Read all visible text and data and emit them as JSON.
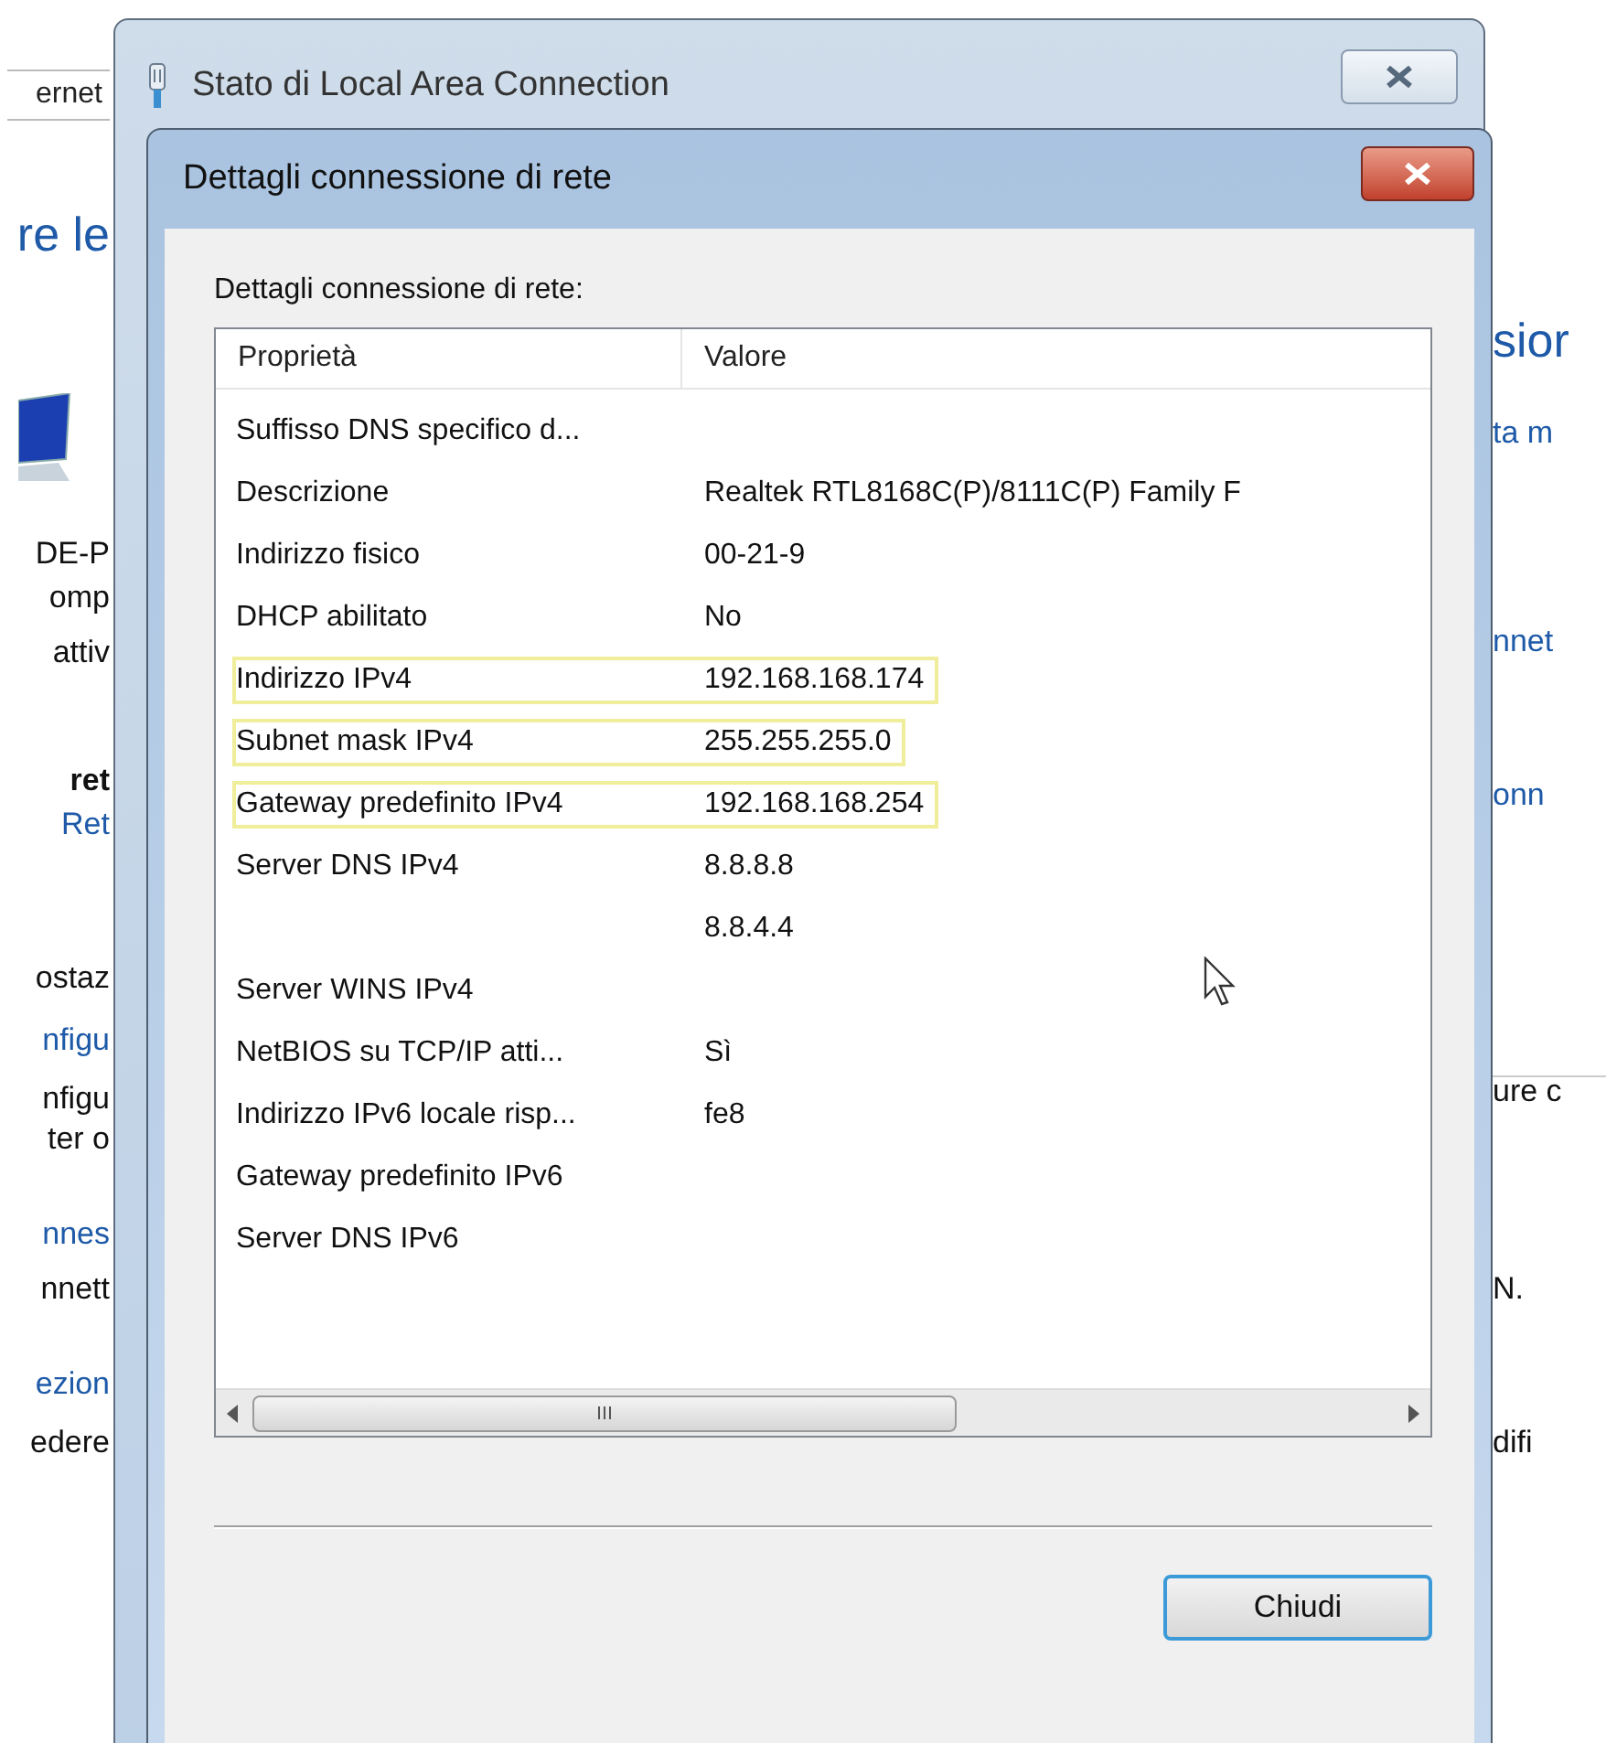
{
  "background_window": {
    "left_fragments": [
      {
        "text": "ernet",
        "kind": "field"
      },
      {
        "text": "re le",
        "kind": "heading"
      },
      {
        "kind": "computer"
      },
      {
        "text": "DE-P",
        "kind": "text"
      },
      {
        "text": "omp",
        "kind": "text"
      },
      {
        "text": "attiv",
        "kind": "text"
      },
      {
        "text": "ret",
        "kind": "bold"
      },
      {
        "text": "Ret",
        "kind": "link"
      },
      {
        "text": "ostaz",
        "kind": "text"
      },
      {
        "text": "nfigu",
        "kind": "link"
      },
      {
        "text": "nfigu",
        "kind": "text"
      },
      {
        "text": "ter o",
        "kind": "text"
      },
      {
        "text": "nnes",
        "kind": "link"
      },
      {
        "text": "nnett",
        "kind": "text"
      },
      {
        "text": "ezion",
        "kind": "link"
      },
      {
        "text": "edere",
        "kind": "text"
      }
    ],
    "right_fragments": [
      {
        "text": "sior",
        "kind": "heading"
      },
      {
        "text": "ta m",
        "kind": "link"
      },
      {
        "text": "nnet",
        "kind": "link"
      },
      {
        "text": "onn",
        "kind": "link"
      },
      {
        "text": "ure c",
        "kind": "text"
      },
      {
        "text": "N.",
        "kind": "text"
      },
      {
        "text": "difi",
        "kind": "text"
      }
    ]
  },
  "status_dialog": {
    "title": "Stato di Local Area Connection"
  },
  "details_dialog": {
    "title": "Dettagli connessione di rete",
    "label": "Dettagli connessione di rete:",
    "columns": [
      "Proprietà",
      "Valore"
    ],
    "rows": [
      {
        "property": "Suffisso DNS specifico d...",
        "highlighted": false
      },
      {
        "property": "Descrizione",
        "value": "Realtek RTL8168C(P)/8111C(P) Family F",
        "highlighted": false
      },
      {
        "property": "Indirizzo fisico",
        "value": "00-21-9",
        "highlighted": false
      },
      {
        "property": "DHCP abilitato",
        "value": "No",
        "highlighted": false
      },
      {
        "property": "Indirizzo IPv4",
        "value": "192.168.168.174",
        "highlighted": true
      },
      {
        "property": "Subnet mask IPv4",
        "value": "255.255.255.0",
        "highlighted": true
      },
      {
        "property": "Gateway predefinito IPv4",
        "value": "192.168.168.254",
        "highlighted": true
      },
      {
        "property": "Server DNS IPv4",
        "value": "8.8.8.8",
        "highlighted": false
      },
      {
        "value": "8.8.4.4",
        "highlighted": false
      },
      {
        "property": "Server WINS IPv4",
        "highlighted": false
      },
      {
        "property": "NetBIOS su TCP/IP atti...",
        "value": "Sì",
        "highlighted": false
      },
      {
        "property": "Indirizzo IPv6 locale risp...",
        "value": "fe8",
        "highlighted": false
      },
      {
        "property": "Gateway predefinito IPv6",
        "highlighted": false
      },
      {
        "property": "Server DNS IPv6",
        "highlighted": false
      }
    ],
    "buttons": [
      "Chiudi"
    ]
  }
}
